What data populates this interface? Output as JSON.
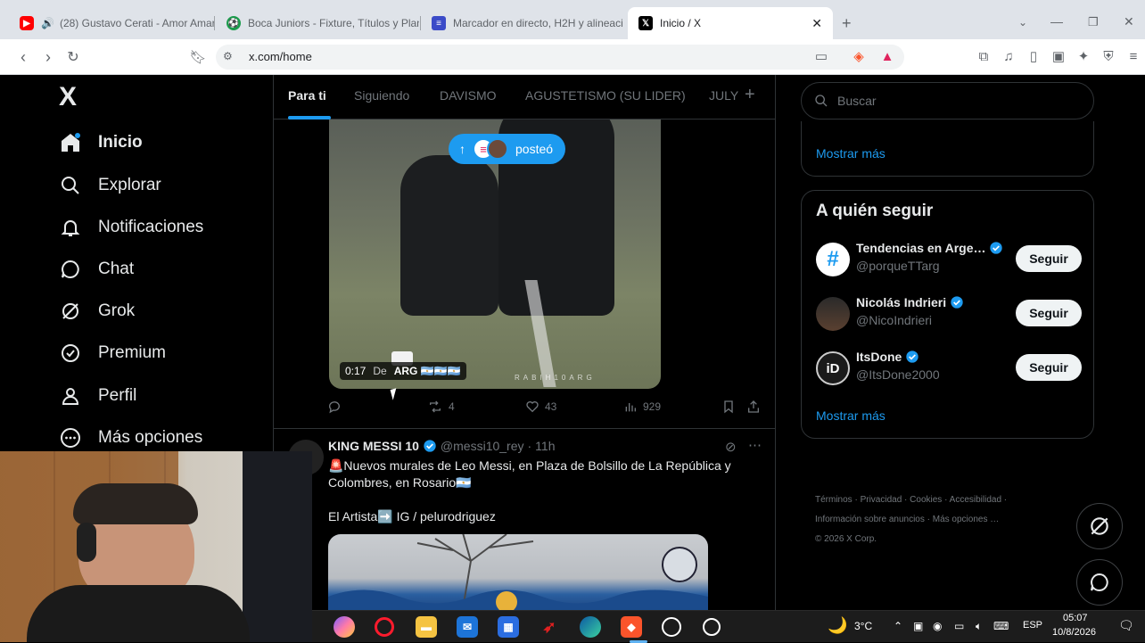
{
  "browser": {
    "tabs": [
      {
        "title": "(28) Gustavo Cerati - Amor Amar",
        "favicon": "youtube-icon",
        "color": "#ff0000"
      },
      {
        "title": "Boca Juniors - Fixture, Títulos y Plant",
        "favicon": "soccer-icon",
        "color": "#1a9b4b"
      },
      {
        "title": "Marcador en directo, H2H y alineaci",
        "favicon": "flashscore-icon",
        "color": "#3b4bc8"
      },
      {
        "title": "Inicio / X",
        "favicon": "x-icon",
        "color": "#000000"
      }
    ],
    "url": "x.com/home",
    "new_tab": "+"
  },
  "nav": {
    "logo": "X",
    "items": [
      {
        "label": "Inicio",
        "icon": "home-icon"
      },
      {
        "label": "Explorar",
        "icon": "search-icon"
      },
      {
        "label": "Notificaciones",
        "icon": "bell-icon"
      },
      {
        "label": "Chat",
        "icon": "chat-icon"
      },
      {
        "label": "Grok",
        "icon": "grok-icon"
      },
      {
        "label": "Premium",
        "icon": "verified-icon"
      },
      {
        "label": "Perfil",
        "icon": "person-icon"
      },
      {
        "label": "Más opciones",
        "icon": "more-circle-icon"
      }
    ]
  },
  "feed": {
    "tabs": [
      "Para ti",
      "Siguiendo",
      "DAVISMO",
      "AGUSTETISMO (SU LIDER)",
      "JULY"
    ],
    "add_tab": "+",
    "new_posts_pill": "posteó",
    "video": {
      "time": "0:17",
      "source_prefix": "De",
      "source_name": "ARG 🇦🇷🇦🇷🇦🇷",
      "watermark": "RABIH10ARG"
    },
    "video_actions": {
      "replies": "",
      "reposts": "4",
      "likes": "43",
      "views": "929"
    },
    "tweet": {
      "name": "KING MESSI 10",
      "handle": "@messi10_rey",
      "sep": "·",
      "time": "11h",
      "line1": "🚨Nuevos murales de Leo Messi, en Plaza de Bolsillo de La República y Colombres, en Rosario🇦🇷",
      "line2": "El Artista➡️ IG / pelurodriguez"
    }
  },
  "right": {
    "search_placeholder": "Buscar",
    "show_more_top": "Mostrar más",
    "who_to_follow": "A quién seguir",
    "suggestions": [
      {
        "name": "Tendencias en Arge…",
        "handle": "@porqueTTarg",
        "button": "Seguir"
      },
      {
        "name": "Nicolás Indrieri",
        "handle": "@NicoIndrieri",
        "button": "Seguir"
      },
      {
        "name": "ItsDone",
        "handle": "@ItsDone2000",
        "button": "Seguir"
      }
    ],
    "show_more": "Mostrar más",
    "footer_links": [
      "Términos",
      "Privacidad",
      "Cookies",
      "Accesibilidad",
      "Información sobre anuncios",
      "Más opciones …"
    ],
    "copyright": "© 2026 X Corp."
  },
  "taskbar": {
    "weather": "3°C",
    "language": "ESP",
    "time": "05:07",
    "date": "10/8/2026"
  }
}
